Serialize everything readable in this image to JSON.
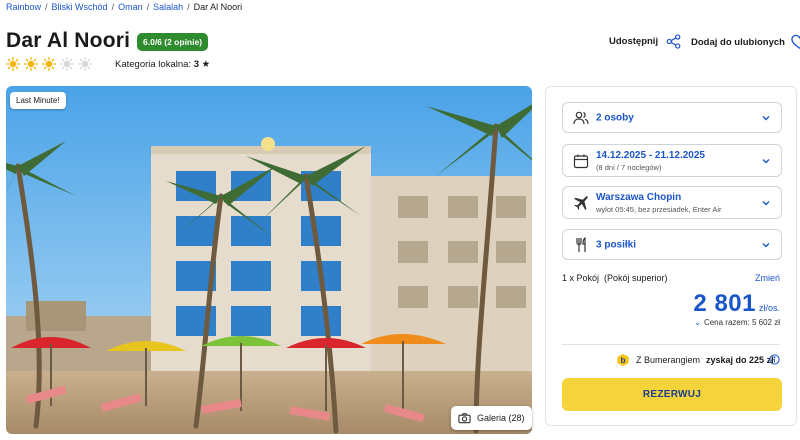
{
  "breadcrumb": [
    "Rainbow",
    "Bliski Wschód",
    "Oman",
    "Salalah",
    "Dar Al Noori"
  ],
  "hotel": {
    "name": "Dar Al Noori",
    "rating_badge": "6.0/6 (2 opinie)",
    "sun_rating": 3,
    "sun_max": 5,
    "local_category_label": "Kategoria lokalna:",
    "local_category_value": "3"
  },
  "actions": {
    "share_label": "Udostępnij",
    "favorite_label": "Dodaj do ulubionych"
  },
  "photo": {
    "tag": "Last Minute!",
    "gallery_label": "Galeria (28)"
  },
  "booking": {
    "persons": "2 osoby",
    "dates": "14.12.2025 - 21.12.2025",
    "dates_sub": "(8 dni / 7 noclegów)",
    "departure": "Warszawa Chopin",
    "departure_sub": "wylot 05:45, bez przesiadek, Enter Air",
    "meals": "3 posiłki",
    "room": "1 x Pokój  (Pokój superior)",
    "change_label": "Zmień",
    "price": "2 801",
    "price_unit": "zł/os.",
    "total": "Cena razem: 5 602 zł",
    "bumerang_prefix": "Z Bumerangiem",
    "bumerang_bold": "zyskaj do 225 zł",
    "reserve_label": "REZERWUJ"
  },
  "colors": {
    "accent_blue": "#1b56c9",
    "badge_green": "#2e8b2e",
    "reserve_yellow": "#f5d33a",
    "sun_active": "#f4b400",
    "sun_inactive": "#d6d6d6"
  }
}
